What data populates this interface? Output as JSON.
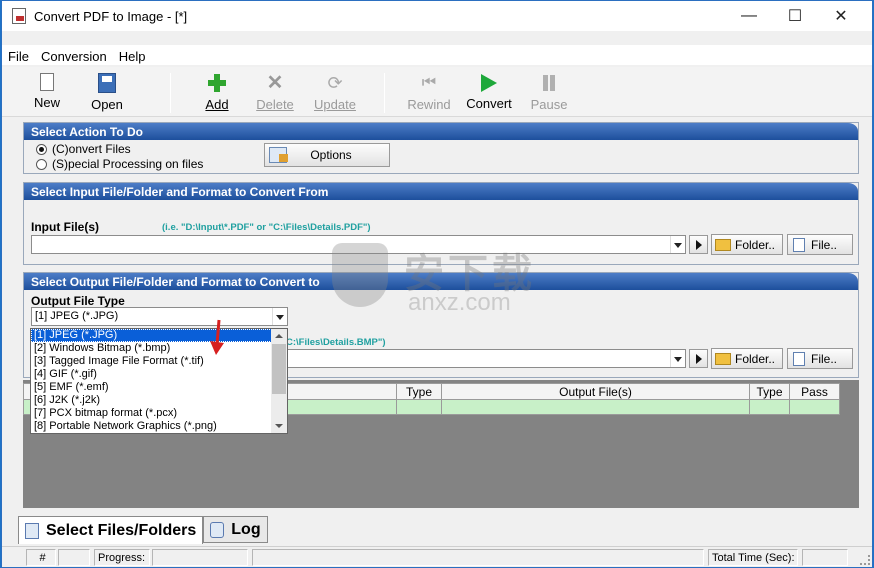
{
  "window": {
    "title": "Convert PDF to Image - [*]",
    "min": "—",
    "max": "☐",
    "close": "✕"
  },
  "menu": [
    "File",
    "Conversion",
    "Help"
  ],
  "toolbar": {
    "new": "New",
    "open": "Open",
    "add": "Add",
    "delete": "Delete",
    "update": "Update",
    "rewind": "Rewind",
    "convert": "Convert",
    "pause": "Pause"
  },
  "action": {
    "header": "Select Action To Do",
    "convert_files": "(C)onvert Files",
    "special": "(S)pecial Processing on files",
    "options": "Options",
    "selected": "convert_files"
  },
  "input": {
    "header": "Select Input File/Folder and Format to Convert From",
    "label": "Input File(s)",
    "hint": "(i.e. \"D:\\Input\\*.PDF\"  or \"C:\\Files\\Details.PDF\")",
    "value": "",
    "folder_btn": "Folder..",
    "file_btn": "File.."
  },
  "output": {
    "header": "Select Output File/Folder and Format to Convert to",
    "type_label": "Output File Type",
    "type_value": "[1] JPEG (*.JPG)",
    "hint_tail": "C:\\Files\\Details.BMP\")",
    "folder_btn": "Folder..",
    "file_btn": "File..",
    "options": [
      "[1] JPEG (*.JPG)",
      "[2] Windows Bitmap (*.bmp)",
      "[3] Tagged Image File Format (*.tif)",
      "[4] GIF (*.gif)",
      "[5] EMF (*.emf)",
      "[6] J2K (*.j2k)",
      "[7] PCX bitmap format (*.pcx)",
      "[8] Portable Network Graphics (*.png)"
    ]
  },
  "grid": {
    "col_type1": "Type",
    "col_output": "Output File(s)",
    "col_type2": "Type",
    "col_pass": "Pass"
  },
  "tabs": {
    "select": "Select Files/Folders",
    "log": "Log"
  },
  "status": {
    "num": "#",
    "progress": "Progress:",
    "total_time": "Total Time (Sec):"
  },
  "watermark": {
    "cn": "安下载",
    "en": "anxz.com"
  },
  "colors": {
    "section_header": "#1d4f9c",
    "selected_option": "#0a5fd8",
    "grid_row": "#c8f0c8",
    "hint": "#20a0a0"
  }
}
